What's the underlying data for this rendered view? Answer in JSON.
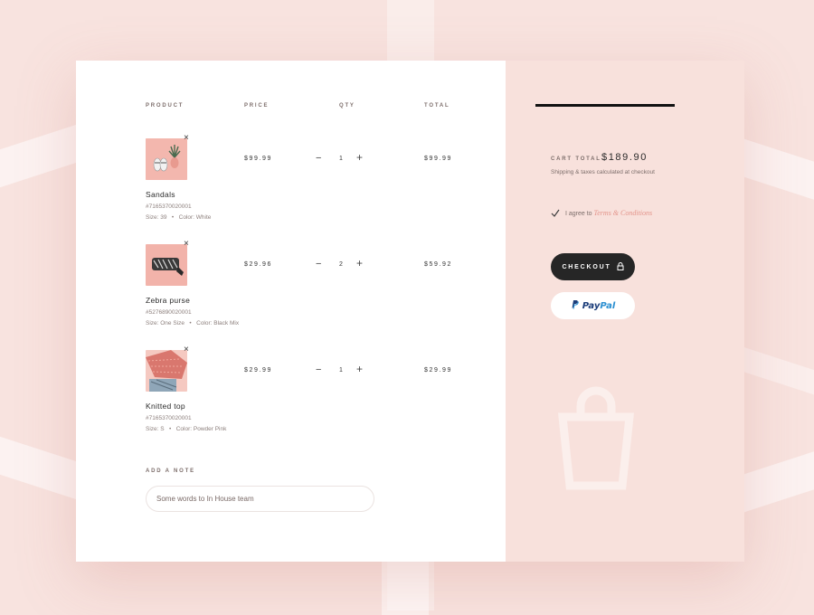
{
  "columns": {
    "product": "PRODUCT",
    "price": "PRICE",
    "qty": "QTY",
    "total": "TOTAL"
  },
  "remove_glyph": "×",
  "minus_glyph": "−",
  "plus_glyph": "+",
  "items": [
    {
      "name": "Sandals",
      "sku": "#7165370020001",
      "size": "Size: 39",
      "sep": "•",
      "color": "Color: White",
      "price": "$99.99",
      "qty": "1",
      "total": "$99.99",
      "image": "sandals-pineapple-photo"
    },
    {
      "name": "Zebra purse",
      "sku": "#5276890020001",
      "size": "Size: One Size",
      "sep": "•",
      "color": "Color: Black Mix",
      "price": "$29.96",
      "qty": "2",
      "total": "$59.92",
      "image": "zebra-purse-photo"
    },
    {
      "name": "Knitted top",
      "sku": "#7165370020001",
      "size": "Size: S",
      "sep": "•",
      "color": "Color: Powder Pink",
      "price": "$29.99",
      "qty": "1",
      "total": "$29.99",
      "image": "knitted-top-photo"
    }
  ],
  "note": {
    "label": "ADD A NOTE",
    "placeholder": "Some words to In House team"
  },
  "summary": {
    "cart_total_label": "CART TOTAL",
    "cart_total_value": "$189.90",
    "shipping_note": "Shipping & taxes calculated at checkout",
    "agree_text": "I agree to",
    "terms_link": "Terms & Conditions",
    "agree_checked": true,
    "checkout_label": "CHECKOUT",
    "paypal_pay": "Pay",
    "paypal_pal": "Pal"
  },
  "colors": {
    "accent": "#e3948b",
    "background": "#f8e3df",
    "panel": "#f8e1dc",
    "button": "#262626"
  },
  "icons": [
    "close-icon",
    "minus-icon",
    "plus-icon",
    "checkmark-icon",
    "lock-icon",
    "paypal-logo",
    "shopping-bag-icon"
  ]
}
